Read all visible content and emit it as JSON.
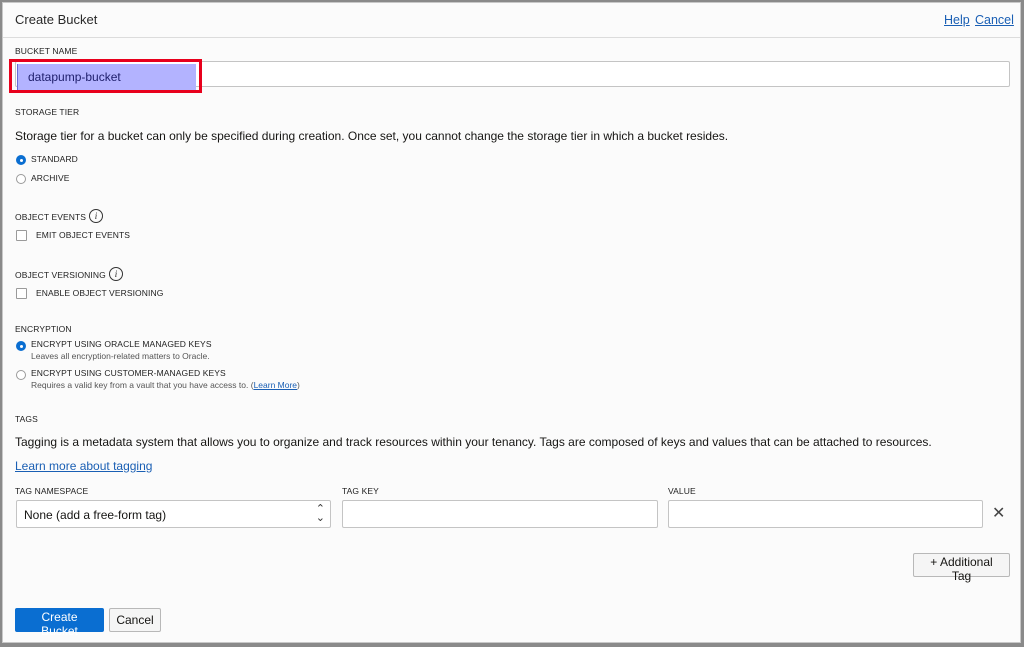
{
  "dialog": {
    "title": "Create Bucket",
    "help_link": "Help",
    "cancel_link": "Cancel"
  },
  "bucket_name": {
    "label": "BUCKET NAME",
    "value": "datapump-bucket"
  },
  "storage_tier": {
    "label": "STORAGE TIER",
    "description": "Storage tier for a bucket can only be specified during creation. Once set, you cannot change the storage tier in which a bucket resides.",
    "options": [
      {
        "label": "STANDARD",
        "selected": true
      },
      {
        "label": "ARCHIVE",
        "selected": false
      }
    ]
  },
  "object_events": {
    "label": "OBJECT EVENTS",
    "checkbox_label": "EMIT OBJECT EVENTS",
    "checked": false
  },
  "object_versioning": {
    "label": "OBJECT VERSIONING",
    "checkbox_label": "ENABLE OBJECT VERSIONING",
    "checked": false
  },
  "encryption": {
    "label": "ENCRYPTION",
    "options": [
      {
        "label": "ENCRYPT USING ORACLE MANAGED KEYS",
        "description": "Leaves all encryption-related matters to Oracle.",
        "selected": true
      },
      {
        "label": "ENCRYPT USING CUSTOMER-MANAGED KEYS",
        "description": "Requires a valid key from a vault that you have access to.",
        "link_open": "(",
        "link": "Learn More",
        "link_close": ")",
        "selected": false
      }
    ]
  },
  "tags": {
    "label": "TAGS",
    "description": "Tagging is a metadata system that allows you to organize and track resources within your tenancy. Tags are composed of keys and values that can be attached to resources.",
    "learn_link": "Learn more about tagging",
    "namespace_label": "TAG NAMESPACE",
    "namespace_value": "None (add a free-form tag)",
    "key_label": "TAG KEY",
    "key_value": "",
    "value_label": "VALUE",
    "value_value": "",
    "additional_tag_button": "+ Additional Tag"
  },
  "footer": {
    "create_button": "Create Bucket",
    "cancel_button": "Cancel"
  },
  "colors": {
    "primary": "#0a6ed1",
    "link": "#1a5fb4",
    "highlight_border": "#e8001c",
    "selection": "#b3b3ff"
  }
}
